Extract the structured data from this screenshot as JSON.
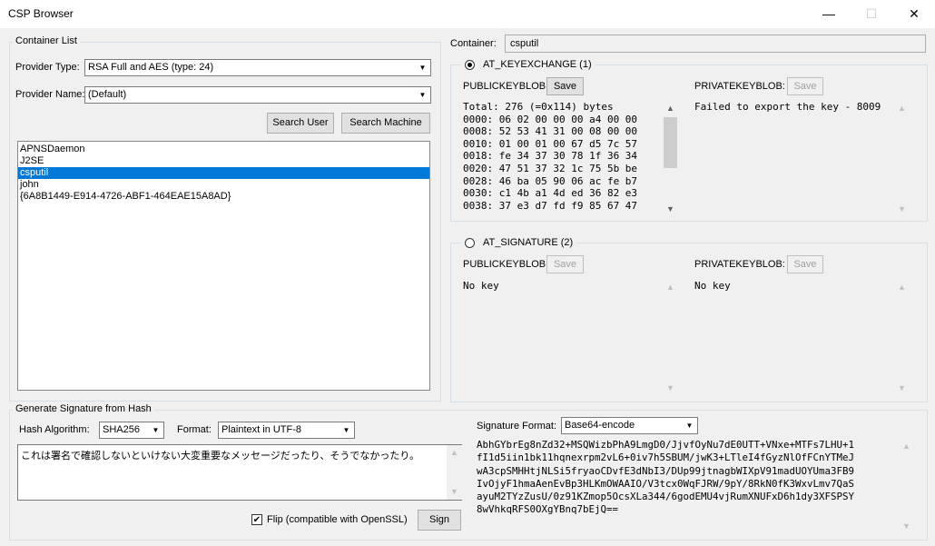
{
  "window": {
    "title": "CSP Browser",
    "minimize_glyph": "—",
    "maximize_glyph": "☐",
    "close_glyph": "✕"
  },
  "container_list": {
    "legend": "Container List",
    "provider_type_label": "Provider Type:",
    "provider_type_value": "RSA Full and AES  (type: 24)",
    "provider_name_label": "Provider Name:",
    "provider_name_value": "(Default)",
    "search_user_label": "Search User",
    "search_machine_label": "Search Machine",
    "items": [
      {
        "label": "APNSDaemon",
        "selected": false
      },
      {
        "label": "J2SE",
        "selected": false
      },
      {
        "label": "csputil",
        "selected": true
      },
      {
        "label": "john",
        "selected": false
      },
      {
        "label": "{6A8B1449-E914-4726-ABF1-464EAE15A8AD}",
        "selected": false
      }
    ]
  },
  "container": {
    "label": "Container:",
    "value": "csputil"
  },
  "keyexchange": {
    "radio_label": "AT_KEYEXCHANGE (1)",
    "selected": true,
    "public_label": "PUBLICKEYBLOB:",
    "public_save": "Save",
    "private_label": "PRIVATEKEYBLOB:",
    "private_save": "Save",
    "public_text": "Total: 276 (=0x114) bytes\n0000: 06 02 00 00 00 a4 00 00\n0008: 52 53 41 31 00 08 00 00\n0010: 01 00 01 00 67 d5 7c 57\n0018: fe 34 37 30 78 1f 36 34\n0020: 47 51 37 32 1c 75 5b be\n0028: 46 ba 05 90 06 ac fe b7\n0030: c1 4b a1 4d ed 36 82 e3\n0038: 37 e3 d7 fd f9 85 67 47",
    "private_text": "Failed to export the key - 8009"
  },
  "signature_key": {
    "radio_label": "AT_SIGNATURE (2)",
    "selected": false,
    "public_label": "PUBLICKEYBLOB:",
    "public_save": "Save",
    "private_label": "PRIVATEKEYBLOB:",
    "private_save": "Save",
    "public_text": "No key",
    "private_text": "No key"
  },
  "gen_sig": {
    "legend": "Generate Signature from Hash",
    "hash_label": "Hash Algorithm:",
    "hash_value": "SHA256",
    "format_label": "Format:",
    "format_value": "Plaintext in UTF-8",
    "message": "これは署名で確認しないといけない大変重要なメッセージだったり、そうでなかったり。",
    "flip_label": "Flip (compatible with OpenSSL)",
    "flip_checked": true,
    "sign_label": "Sign",
    "sig_format_label": "Signature Format:",
    "sig_format_value": "Base64-encode",
    "signature_text": "AbhGYbrEg8nZd32+MSQWizbPhA9LmgD0/JjvfOyNu7dE0UTT+VNxe+MTFs7LHU+1\nfI1d5iin1bk11hqnexrpm2vL6+0iv7h5SBUM/jwK3+LTleI4fGyzNlOfFCnYTMeJ\nwA3cpSMHHtjNLSi5fryaoCDvfE3dNbI3/DUp99jtnagbWIXpV91madUOYUma3FB9\nIvOjyF1hmaAenEvBp3HLKmOWAAIO/V3tcx0WqFJRW/9pY/8RkN0fK3WxvLmv7QaS\nayuM2TYzZusU/0z91KZmop5OcsXLa344/6godEMU4vjRumXNUFxD6h1dy3XFSPSY\n8wVhkqRFS0OXgYBnq7bEjQ=="
  },
  "icons": {
    "dropdown_arrow": "▼",
    "scroll_up": "▲",
    "scroll_down": "▼",
    "check": "✔"
  }
}
